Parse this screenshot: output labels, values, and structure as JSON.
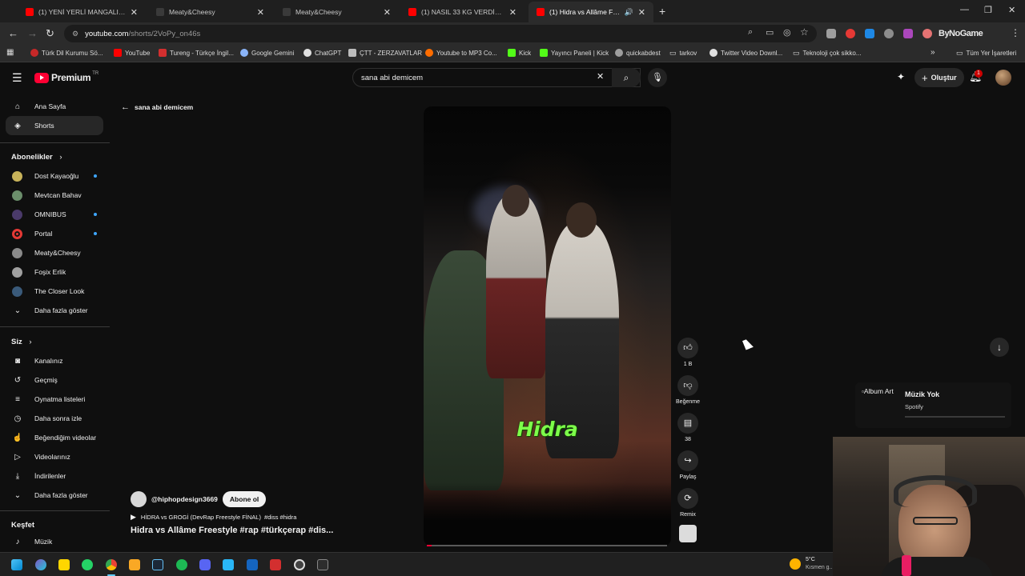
{
  "browser": {
    "tabs": [
      {
        "title": "(1) YENİ YERLİ MANGALIMIZI D...",
        "favicon_color": "#ff0000",
        "active": false
      },
      {
        "title": "Meaty&Cheesy",
        "favicon_color": "#3a3a3a",
        "active": false
      },
      {
        "title": "Meaty&Cheesy",
        "favicon_color": "#3a3a3a",
        "active": false
      },
      {
        "title": "(1) NASIL 33 KG VERDİM ? (Hay...",
        "favicon_color": "#ff0000",
        "active": false
      },
      {
        "title": "(1) Hidra vs Allâme Freestyle...",
        "favicon_color": "#ff0000",
        "active": true
      }
    ],
    "new_tab_symbol": "+",
    "url_host": "youtube.com",
    "url_path": "/shorts/2VoPy_on46s",
    "bookmarks": [
      {
        "label": "Türk Dil Kurumu Sö...",
        "icon_color": "#c62828"
      },
      {
        "label": "YouTube",
        "icon_color": "#ff0000"
      },
      {
        "label": "Tureng - Türkçe İngil...",
        "icon_color": "#d32f2f"
      },
      {
        "label": "Google Gemini",
        "icon_color": "#8ab4f8"
      },
      {
        "label": "ChatGPT",
        "icon_color": "#e0e0e0"
      },
      {
        "label": "ÇTT - ZERZAVATLAR",
        "icon_color": "#bdbdbd"
      },
      {
        "label": "Youtube to MP3 Co...",
        "icon_color": "#ff6d00"
      },
      {
        "label": "Kick",
        "icon_color": "#53fc18"
      },
      {
        "label": "Yayıncı Paneli | Kick",
        "icon_color": "#53fc18"
      },
      {
        "label": "quickabdest",
        "icon_color": "#9e9e9e"
      },
      {
        "label": "tarkov",
        "icon_color": "#bdbdbd"
      },
      {
        "label": "Twitter Video Downl...",
        "icon_color": "#e0e0e0"
      },
      {
        "label": "Teknoloji çok sikko...",
        "icon_color": "#bdbdbd"
      }
    ],
    "all_bookmarks": "Tüm Yer İşaretleri",
    "overlay_text": "ByNoGame"
  },
  "youtube": {
    "logo_text": "Premium",
    "logo_region": "TR",
    "search_value": "sana abi demicem",
    "create_label": "Oluştur",
    "notification_count": "1",
    "back_label": "sana abi demicem"
  },
  "sidebar": {
    "main": [
      {
        "label": "Ana Sayfa",
        "icon": "home-icon",
        "glyph": "⌂"
      },
      {
        "label": "Shorts",
        "icon": "shorts-icon",
        "glyph": "◈",
        "selected": true
      }
    ],
    "subscriptions_title": "Abonelikler",
    "subscriptions": [
      {
        "label": "Dost Kayaoğlu",
        "color": "#c8b35a",
        "dot": true
      },
      {
        "label": "Mevtcan Bahav",
        "color": "#6b8e6b",
        "dot": false
      },
      {
        "label": "OMNIBUS",
        "color": "#4a3a6a",
        "dot": true
      },
      {
        "label": "Portal",
        "color": "#e53935",
        "dot": true
      },
      {
        "label": "Meaty&Cheesy",
        "color": "#8a8a8a",
        "dot": false
      },
      {
        "label": "Foşix Erlik",
        "color": "#a0a0a0",
        "dot": false
      },
      {
        "label": "The Closer Look",
        "color": "#3a5a7a",
        "dot": false
      }
    ],
    "show_more": "Daha fazla göster",
    "you_title": "Siz",
    "you": [
      {
        "label": "Kanalınız",
        "icon": "channel-icon",
        "glyph": "◙"
      },
      {
        "label": "Geçmiş",
        "icon": "history-icon",
        "glyph": "↺"
      },
      {
        "label": "Oynatma listeleri",
        "icon": "playlists-icon",
        "glyph": "≡"
      },
      {
        "label": "Daha sonra izle",
        "icon": "watch-later-icon",
        "glyph": "◷"
      },
      {
        "label": "Beğendiğim videolar",
        "icon": "liked-icon",
        "glyph": "👍"
      },
      {
        "label": "Videolarınız",
        "icon": "your-videos-icon",
        "glyph": "▷"
      },
      {
        "label": "İndirilenler",
        "icon": "downloads-icon",
        "glyph": "⤓"
      }
    ],
    "show_more_2": "Daha fazla göster",
    "explore_title": "Keşfet",
    "explore": [
      {
        "label": "Müzik",
        "icon": "music-icon",
        "glyph": "♪"
      }
    ]
  },
  "short": {
    "caption": "Hidra",
    "channel": "@hiphopdesign3669",
    "subscribe": "Abone ol",
    "playlist": "HİDRA vs GROGİ (DevRap Freestyle FİNAL)",
    "hashtags_small": "#diss #hidra",
    "title": "Hidra vs Allâme Freestyle  #rap #türkçerap #dis...",
    "progress": 0.02,
    "actions": {
      "like_count": "1 B",
      "dislike_label": "Beğenme",
      "comment_count": "38",
      "share_label": "Paylaş",
      "remix_label": "Remix"
    }
  },
  "music_panel": {
    "art_alt": "Album Art",
    "title": "Müzik Yok",
    "subtitle": "Spotify"
  },
  "taskbar": {
    "weather_temp": "5°C",
    "weather_text": "Kısmen g..."
  }
}
